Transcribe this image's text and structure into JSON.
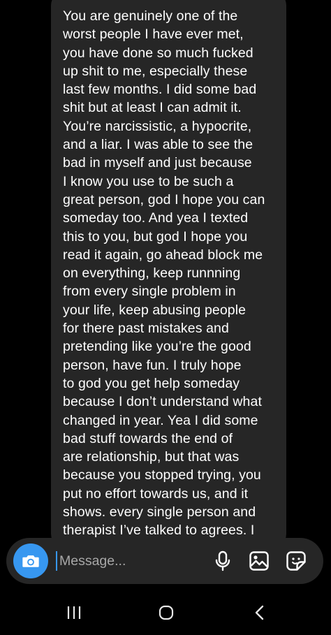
{
  "conversation": {
    "message_lines": [
      "You are genuinely one of the",
      "worst people I have ever met,",
      "you have done so much fucked",
      "up shit to me, especially these",
      "last few months. I did some bad",
      "shit but at least I can admit it.",
      "You’re narcissistic, a hypocrite,",
      "and a liar. I was able to see the",
      "bad in myself and just because",
      "I know you use to be such a",
      "great person, god I hope you can",
      "someday too.  And yea I texted",
      "this to you, but god I hope you",
      "read it again, go ahead block me",
      "on everything, keep runnning",
      "from every single problem in",
      "your life, keep abusing people",
      "for there past mistakes and",
      "pretending like you’re the good",
      "person, have fun. I truly hope",
      "to god you get help someday",
      "because I don’t understand what",
      "changed in year. Yea I did some",
      "bad stuff towards the end of",
      "are relationship, but that was",
      "because you stopped trying, you",
      "put no effort towards us, and it",
      "shows. every single person and",
      "therapist I’ve talked to agrees. I"
    ]
  },
  "composer": {
    "placeholder": "Message...",
    "value": "",
    "icons": {
      "camera": "camera-icon",
      "mic": "microphone-icon",
      "gallery": "image-gallery-icon",
      "sticker": "sticker-icon"
    }
  },
  "navbar": {
    "icons": [
      "recent-apps-icon",
      "home-icon",
      "back-icon"
    ]
  },
  "colors": {
    "background": "#000000",
    "bubble": "#262626",
    "accent": "#3797f0",
    "text": "#ffffff",
    "placeholder": "#a8a8a8"
  }
}
